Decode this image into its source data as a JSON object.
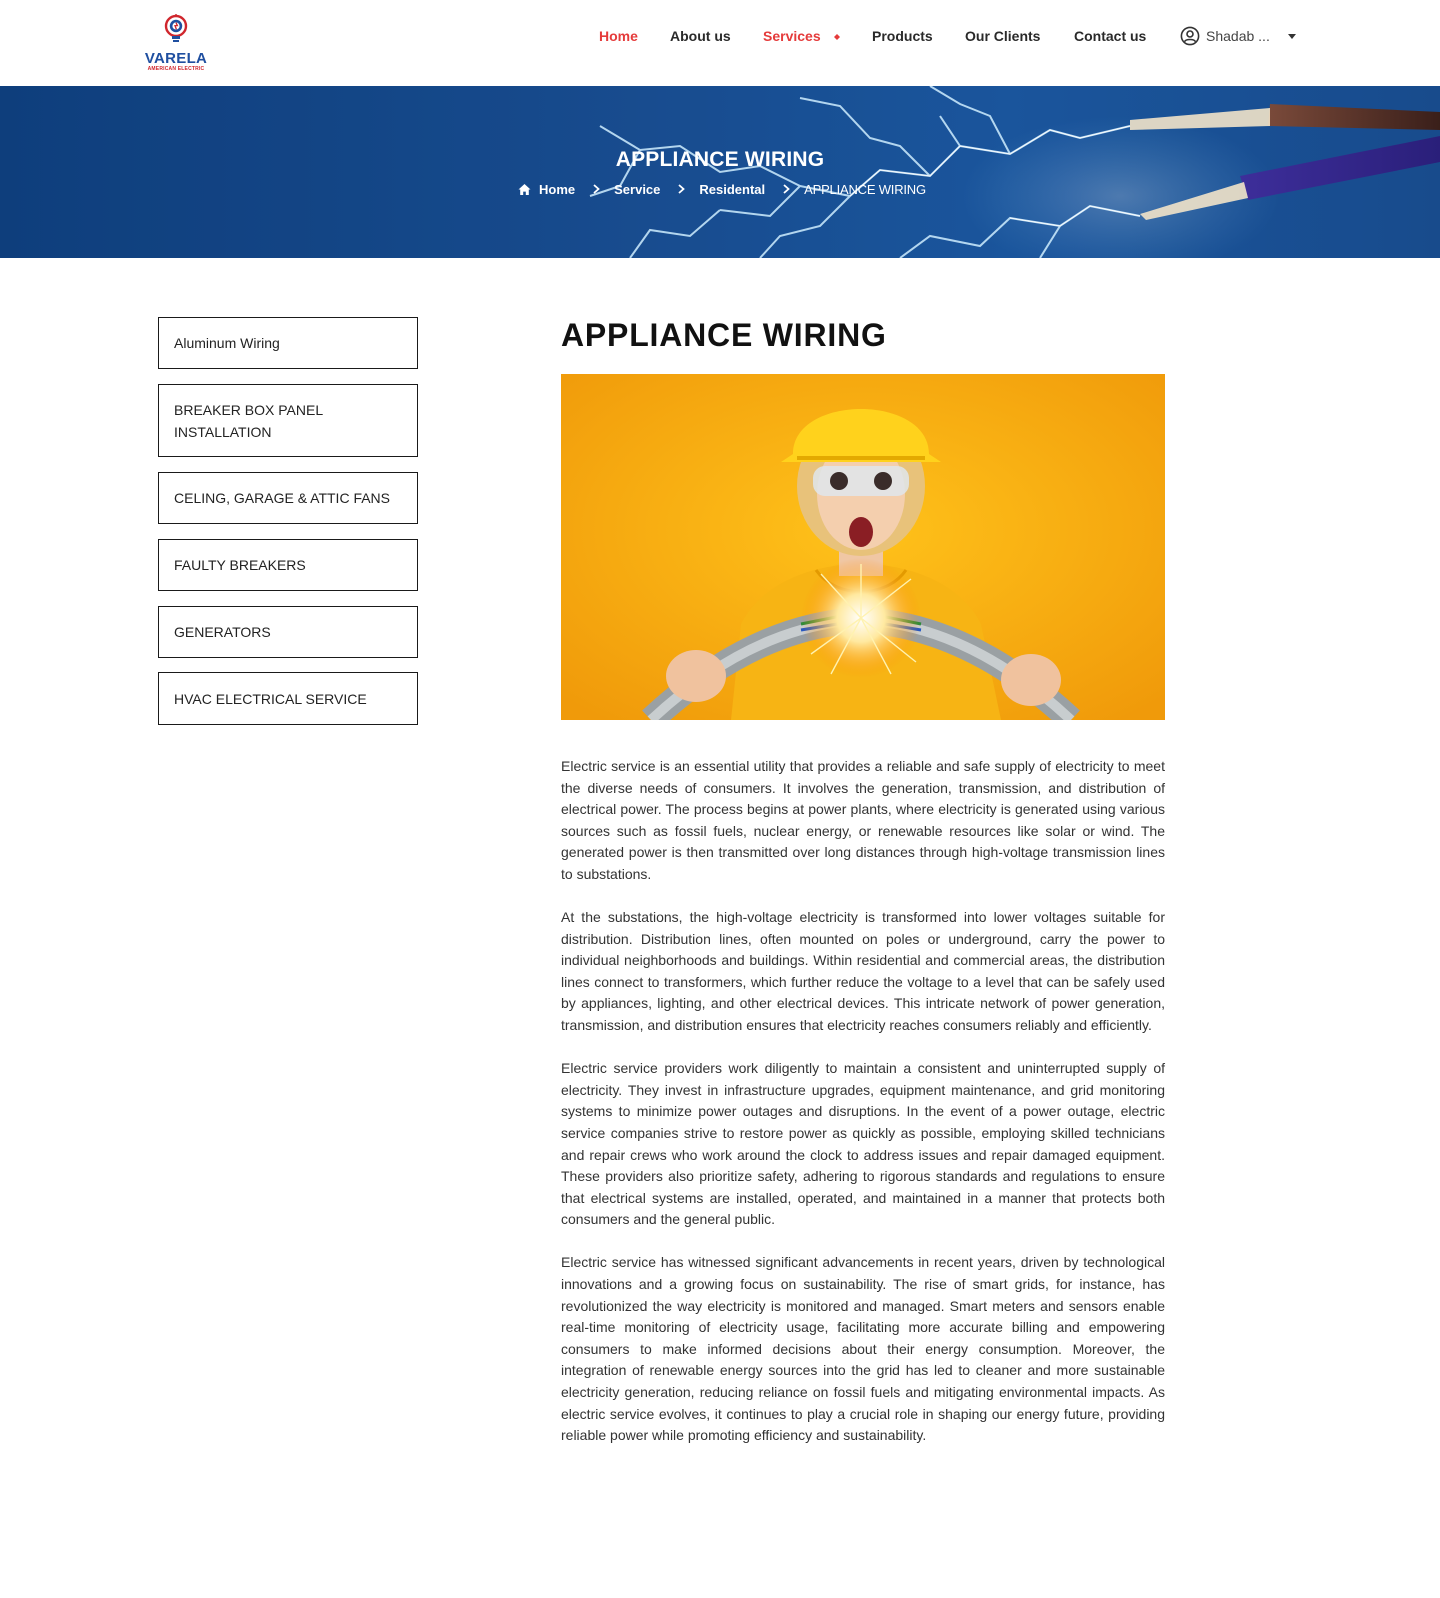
{
  "brand": {
    "name": "VARELA",
    "tagline": "AMERICAN ELECTRIC",
    "primary_color": "#1f4fa0",
    "accent_color": "#e53b3b"
  },
  "nav": {
    "items": [
      {
        "label": "Home",
        "active": true
      },
      {
        "label": "About us",
        "active": false
      },
      {
        "label": "Services",
        "active": true,
        "has_submenu": true
      },
      {
        "label": "Products",
        "active": false
      },
      {
        "label": "Our Clients",
        "active": false
      },
      {
        "label": "Contact us",
        "active": false
      }
    ],
    "user": {
      "name": "Shadab ...",
      "icon": "user-circle-icon"
    }
  },
  "banner": {
    "title": "APPLIANCE WIRING",
    "breadcrumb": [
      {
        "label": "Home",
        "icon": "home-icon"
      },
      {
        "label": "Service"
      },
      {
        "label": "Residental"
      },
      {
        "label": "APPLIANCE WIRING",
        "current": true
      }
    ]
  },
  "sidebar": {
    "items": [
      {
        "label": "Aluminum Wiring"
      },
      {
        "label": "BREAKER BOX PANEL INSTALLATION"
      },
      {
        "label": "CELING, GARAGE & ATTIC FANS"
      },
      {
        "label": "FAULTY BREAKERS"
      },
      {
        "label": "GENERATORS"
      },
      {
        "label": "HVAC ELECTRICAL SERVICE"
      }
    ]
  },
  "main": {
    "title": "APPLIANCE WIRING",
    "paragraphs": [
      "Electric service is an essential utility that provides a reliable and safe supply of electricity to meet the diverse needs of consumers. It involves the generation, transmission, and distribution of electrical power. The process begins at power plants, where electricity is generated using various sources such as fossil fuels, nuclear energy, or renewable resources like solar or wind. The generated power is then transmitted over long distances through high-voltage transmission lines to substations.",
      "At the substations, the high-voltage electricity is transformed into lower voltages suitable for distribution. Distribution lines, often mounted on poles or underground, carry the power to individual neighborhoods and buildings. Within residential and commercial areas, the distribution lines connect to transformers, which further reduce the voltage to a level that can be safely used by appliances, lighting, and other electrical devices. This intricate network of power generation, transmission, and distribution ensures that electricity reaches consumers reliably and efficiently.",
      "Electric service providers work diligently to maintain a consistent and uninterrupted supply of electricity. They invest in infrastructure upgrades, equipment maintenance, and grid monitoring systems to minimize power outages and disruptions. In the event of a power outage, electric service companies strive to restore power as quickly as possible, employing skilled technicians and repair crews who work around the clock to address issues and repair damaged equipment. These providers also prioritize safety, adhering to rigorous standards and regulations to ensure that electrical systems are installed, operated, and maintained in a manner that protects both consumers and the general public.",
      "Electric service has witnessed significant advancements in recent years, driven by technological innovations and a growing focus on sustainability. The rise of smart grids, for instance, has revolutionized the way electricity is monitored and managed. Smart meters and sensors enable real-time monitoring of electricity usage, facilitating more accurate billing and empowering consumers to make informed decisions about their energy consumption. Moreover, the integration of renewable energy sources into the grid has led to cleaner and more sustainable electricity generation, reducing reliance on fossil fuels and mitigating environmental impacts. As electric service evolves, it continues to play a crucial role in shaping our energy future, providing reliable power while promoting efficiency and sustainability."
    ]
  }
}
